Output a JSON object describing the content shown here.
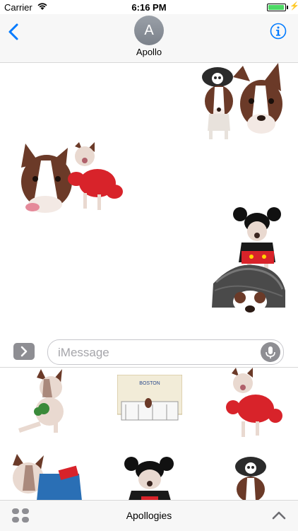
{
  "status_bar": {
    "carrier": "Carrier",
    "time": "6:16 PM"
  },
  "header": {
    "avatar_initial": "A",
    "contact_name": "Apollo",
    "back_icon": "chevron-left-icon",
    "info_icon": "info-icon"
  },
  "conversation": {
    "stickers": [
      {
        "name": "dog-pair-panda-hat-sticker",
        "side": "right"
      },
      {
        "name": "dog-head-and-lobster-costume-sticker",
        "side": "left"
      },
      {
        "name": "dog-mickey-costume-sticker",
        "side": "right"
      },
      {
        "name": "dog-under-blanket-sticker",
        "side": "right"
      }
    ]
  },
  "input_bar": {
    "placeholder": "iMessage",
    "apps_icon": "chevron-right-icon",
    "mic_icon": "microphone-icon"
  },
  "drawer": {
    "stickers": [
      "dog-with-green-bow",
      "dog-on-bench-sign",
      "dog-lobster-costume",
      "dog-blue-bag",
      "dog-mickey-costume",
      "dog-panda-hat"
    ]
  },
  "bottom_bar": {
    "pack_name": "Apollogies",
    "grid_icon": "app-drawer-grid-icon",
    "expand_icon": "chevron-up-icon"
  },
  "colors": {
    "accent": "#007aff",
    "battery": "#4cd964",
    "gray": "#8e8e93"
  }
}
